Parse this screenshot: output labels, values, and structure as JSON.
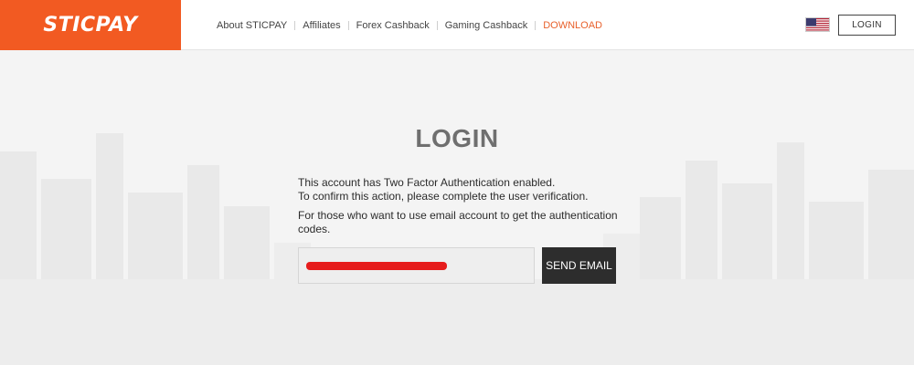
{
  "header": {
    "logo_text": "STICPAY",
    "nav": [
      {
        "label": "About STICPAY"
      },
      {
        "label": "Affiliates"
      },
      {
        "label": "Forex Cashback"
      },
      {
        "label": "Gaming Cashback"
      },
      {
        "label": "DOWNLOAD"
      }
    ],
    "language_flag_icon": "us-flag-icon",
    "login_label": "LOGIN"
  },
  "main": {
    "title": "LOGIN",
    "message_line1": "This account has Two Factor Authentication enabled.",
    "message_line2": "To confirm this action, please complete the user verification.",
    "email_info": "For those who want to use email account to get the authentication codes.",
    "email_value": "",
    "send_email_label": "SEND EMAIL"
  },
  "colors": {
    "brand_orange": "#f25a22",
    "download_link": "#e8612c",
    "send_button": "#2d2d2d",
    "redaction": "#e61c1c"
  }
}
